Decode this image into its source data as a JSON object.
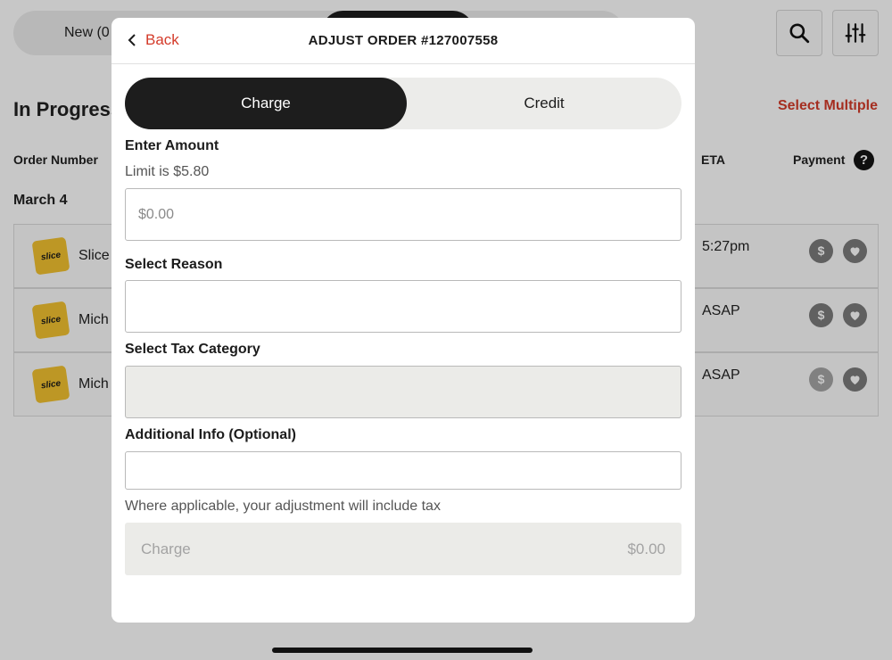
{
  "background": {
    "tabs": {
      "new_label": "New (0"
    },
    "section_title": "In Progress",
    "select_multiple": "Select Multiple",
    "columns": {
      "order_number": "Order Number",
      "eta": "ETA",
      "payment": "Payment"
    },
    "help_glyph": "?",
    "date_heading": "March 4",
    "logo_text": "slice",
    "dollar_glyph": "$",
    "orders": [
      {
        "name": "Slice",
        "eta": "5:27pm"
      },
      {
        "name": "Mich",
        "eta": "ASAP"
      },
      {
        "name": "Mich",
        "eta": "ASAP"
      }
    ]
  },
  "modal": {
    "back_label": "Back",
    "title": "ADJUST ORDER #127007558",
    "segment": {
      "charge": "Charge",
      "credit": "Credit"
    },
    "amount": {
      "label": "Enter Amount",
      "limit": "Limit is $5.80",
      "placeholder": "$0.00"
    },
    "reason": {
      "label": "Select Reason"
    },
    "tax": {
      "label": "Select Tax Category"
    },
    "additional": {
      "label": "Additional Info (Optional)",
      "placeholder": ""
    },
    "tax_note": "Where applicable, your adjustment will include tax",
    "submit": {
      "label": "Charge",
      "amount": "$0.00"
    }
  },
  "colors": {
    "accent": "#d43b2a",
    "dark": "#1d1d1d",
    "logo": "#f2c230"
  }
}
